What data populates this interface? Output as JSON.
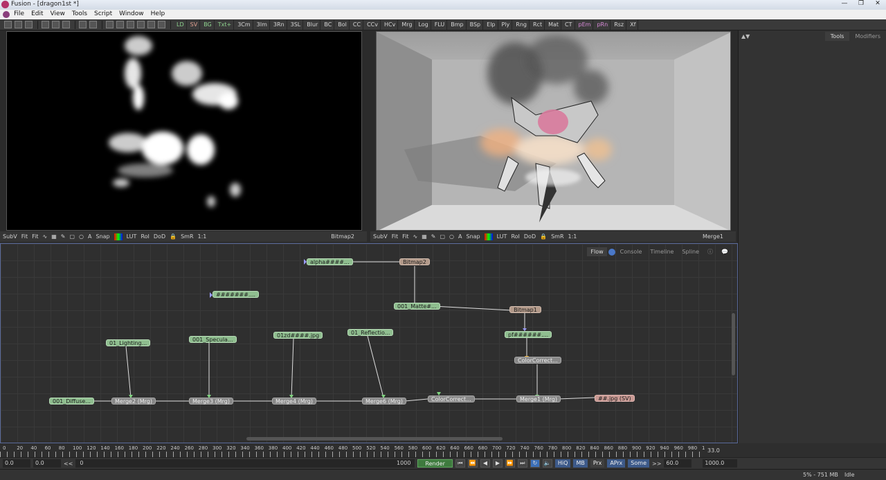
{
  "window": {
    "title": "Fusion - [dragon1st *]",
    "buttons": [
      "—",
      "❐",
      "✕"
    ]
  },
  "menu": [
    "File",
    "Edit",
    "View",
    "Tools",
    "Script",
    "Window",
    "Help"
  ],
  "toolbar": {
    "tools": [
      "LD",
      "SV",
      "BG",
      "Txt+",
      "3Cm",
      "3Im",
      "3Rn",
      "3SL",
      "Blur",
      "BC",
      "Bol",
      "CC",
      "CCv",
      "HCv",
      "Mrg",
      "Log",
      "FLU",
      "Bmp",
      "BSp",
      "Elp",
      "Ply",
      "Rng",
      "Rct",
      "Mat",
      "CT",
      "pEm",
      "pRn",
      "Rsz",
      "Xf"
    ]
  },
  "viewer_bar": {
    "items": [
      "SubV",
      "Fit",
      "Fit",
      "Snap",
      "LUT",
      "RoI",
      "DoD",
      "SmR",
      "1:1"
    ],
    "left_name": "Bitmap2",
    "right_name": "Merge1"
  },
  "right_panel": {
    "arrows": "▲▼",
    "tabs": [
      "Tools",
      "Modifiers"
    ]
  },
  "flow": {
    "tabs": [
      "Flow",
      "Console",
      "Timeline",
      "Spline"
    ],
    "nodes": {
      "alpha": "alpha####...",
      "bitmap2": "Bitmap2",
      "hashes": "#######....",
      "matte": "001_Matte#...",
      "bitmap1": "Bitmap1",
      "pf": "pf######....",
      "cc_top": "ColorCorrect...",
      "lighting": "01_Lighting...",
      "specular": "001_Specula...",
      "zd": "01zd####.jpg",
      "reflection": "01_Reflectio...",
      "diffuse": "001_Diffuse...",
      "merge2": "Merge2  (Mrg)",
      "merge3": "Merge3  (Mrg)",
      "merge4": "Merge4  (Mrg)",
      "merge6": "Merge6  (Mrg)",
      "cc_bottom": "ColorCorrect...",
      "merge1": "Merge1  (Mrg)",
      "saver": "##.jpg  (SV)"
    }
  },
  "timeline": {
    "ticks": [
      "0",
      "20",
      "40",
      "60",
      "80",
      "100",
      "120",
      "140",
      "160",
      "180",
      "200",
      "220",
      "240",
      "260",
      "280",
      "300",
      "320",
      "340",
      "360",
      "380",
      "400",
      "420",
      "440",
      "460",
      "480",
      "500",
      "520",
      "540",
      "560",
      "580",
      "600",
      "620",
      "640",
      "660",
      "680",
      "700",
      "720",
      "740",
      "760",
      "780",
      "800",
      "820",
      "840",
      "860",
      "880",
      "900",
      "920",
      "940",
      "960",
      "980",
      "1"
    ],
    "current": "33.0"
  },
  "transport": {
    "start": "0.0",
    "render_start": "0.0",
    "prev": "<<",
    "slider_start": "0",
    "slider_end": "1000",
    "render": "Render",
    "hiq": "HiQ",
    "mb": "MB",
    "prx": "Prx",
    "aprx": "APrx",
    "some": "Some",
    "next": ">>",
    "fps": "60.0",
    "end": "1000.0"
  },
  "status": {
    "memory": "5% - 751 MB",
    "state": "Idle"
  }
}
